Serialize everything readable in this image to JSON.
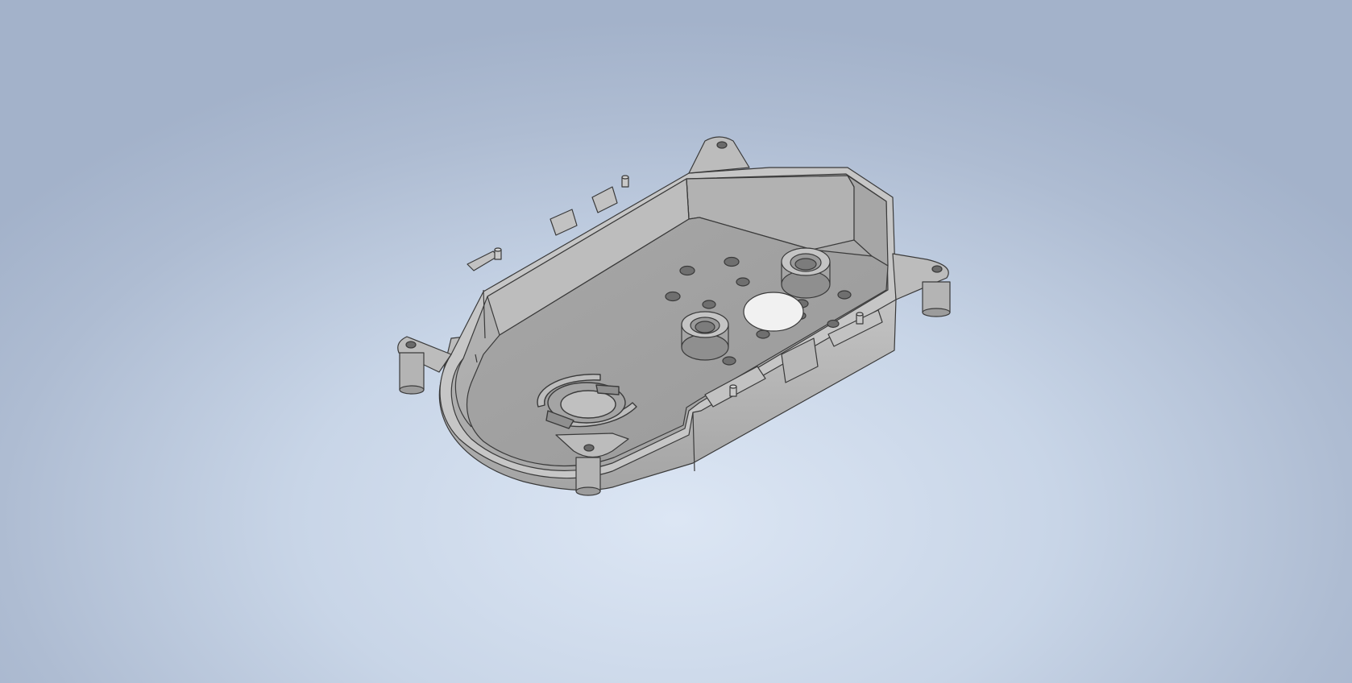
{
  "viewport": {
    "background_top": "#a3b2ca",
    "background_center": "#dce6f4"
  },
  "model": {
    "material_color": "#a9a9a9",
    "shade_dark": "#8e8e8e",
    "shade_light": "#c9c9c9",
    "edge_color": "#3a3a3a"
  }
}
